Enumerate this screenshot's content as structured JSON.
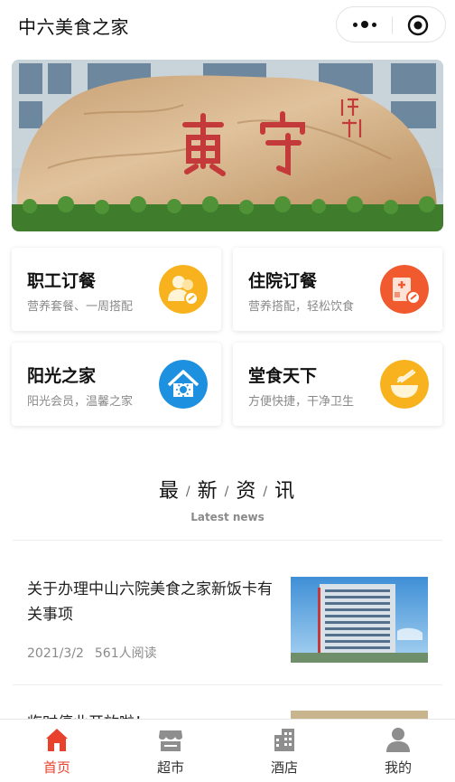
{
  "header": {
    "app_title": "中六美食之家"
  },
  "services": [
    {
      "title": "职工订餐",
      "subtitle": "营养套餐、一周搭配",
      "icon": "staff-meal-icon",
      "color": "#f7b21d"
    },
    {
      "title": "住院订餐",
      "subtitle": "营养搭配，轻松饮食",
      "icon": "hospital-meal-icon",
      "color": "#f05a2e"
    },
    {
      "title": "阳光之家",
      "subtitle": "阳光会员，温馨之家",
      "icon": "sunshine-home-icon",
      "color": "#1e90e0"
    },
    {
      "title": "堂食天下",
      "subtitle": "方便快捷，干净卫生",
      "icon": "dine-in-icon",
      "color": "#f7b21d"
    }
  ],
  "news_section": {
    "title_chars": [
      "最",
      "新",
      "资",
      "讯"
    ],
    "separator": "/",
    "subtitle": "Latest news"
  },
  "news": [
    {
      "title": "关于办理中山六院美食之家新饭卡有关事项",
      "date": "2021/3/2",
      "reads": "561人阅读"
    },
    {
      "title": "临时停业开放啦！"
    }
  ],
  "tabbar": [
    {
      "label": "首页",
      "icon": "home-icon",
      "active": true
    },
    {
      "label": "超市",
      "icon": "store-icon",
      "active": false
    },
    {
      "label": "酒店",
      "icon": "hotel-icon",
      "active": false
    },
    {
      "label": "我的",
      "icon": "user-icon",
      "active": false
    }
  ],
  "colors": {
    "accent": "#e8412c",
    "inactive_icon": "#8e8e8e"
  }
}
